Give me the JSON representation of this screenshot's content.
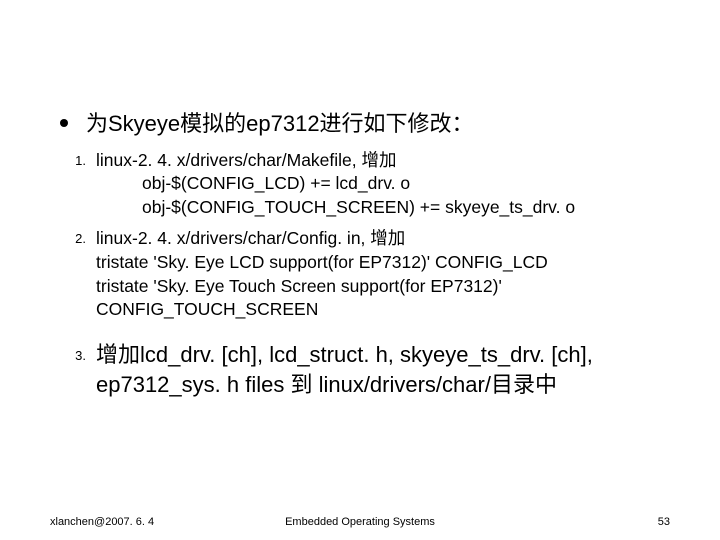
{
  "title": "为Skyeye模拟的ep7312进行如下修改：",
  "items": [
    {
      "num": "1.",
      "head": "linux-2. 4. x/drivers/char/Makefile, 增加",
      "sub1": "obj-$(CONFIG_LCD) += lcd_drv. o",
      "sub2": "obj-$(CONFIG_TOUCH_SCREEN) += skyeye_ts_drv. o"
    },
    {
      "num": "2.",
      "head": "linux-2. 4. x/drivers/char/Config. in, 增加",
      "line2": "tristate 'Sky. Eye LCD support(for EP7312)' CONFIG_LCD",
      "line3": "tristate 'Sky. Eye Touch Screen support(for EP7312)'",
      "line4": "CONFIG_TOUCH_SCREEN"
    },
    {
      "num": "3.",
      "text": "增加lcd_drv. [ch], lcd_struct. h, skyeye_ts_drv. [ch], ep7312_sys. h files 到 linux/drivers/char/目录中"
    }
  ],
  "footer": {
    "left": "xlanchen@2007. 6. 4",
    "center": "Embedded Operating Systems",
    "right": "53"
  }
}
